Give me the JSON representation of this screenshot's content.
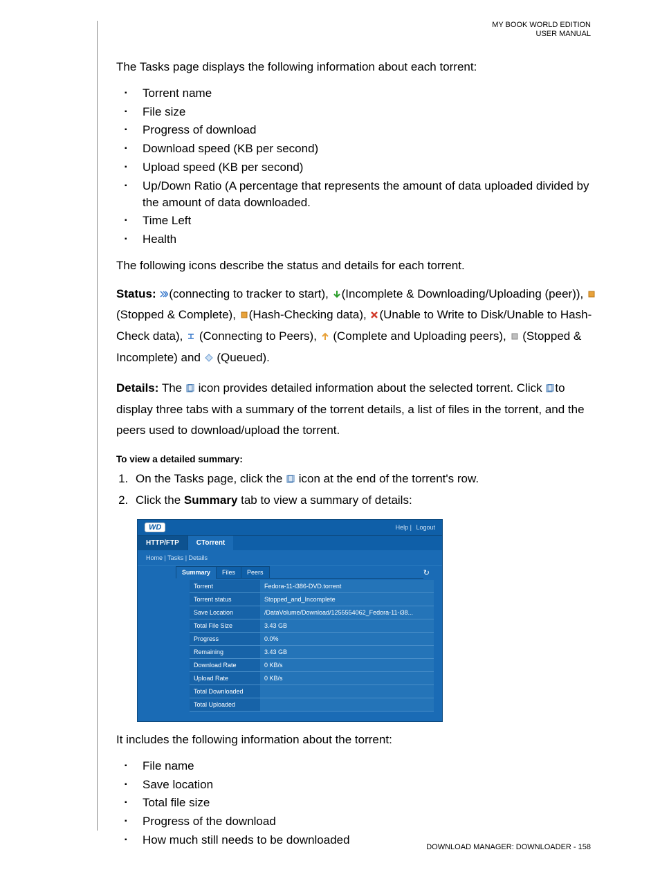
{
  "header": {
    "line1": "MY BOOK WORLD EDITION",
    "line2": "USER MANUAL"
  },
  "intro": "The Tasks page displays the following information about each torrent:",
  "tasks_info": [
    "Torrent name",
    "File size",
    "Progress of download",
    "Download speed (KB per second)",
    "Upload speed (KB per second)",
    "Up/Down Ratio (A percentage that represents the amount of data uploaded divided by the amount of data downloaded.",
    "Time Left",
    "Health"
  ],
  "icons_intro": "The following icons describe the status and details for each torrent.",
  "status": {
    "label": "Status:",
    "s1": "(connecting to tracker to start), ",
    "s2": "(Incomplete & Downloading/Uploading (peer)), ",
    "s3": "(Stopped & Complete), ",
    "s4": "(Hash-Checking data), ",
    "s5": "(Unable to Write to Disk/Unable to Hash-Check data), ",
    "s6": " (Connecting to Peers), ",
    "s7": " (Complete and Uploading peers), ",
    "s8": " (Stopped & Incomplete) and ",
    "s9": " (Queued)."
  },
  "details": {
    "label": "Details:",
    "t1": " The ",
    "t2": " icon provides detailed information about the selected torrent. Click ",
    "t3": "to display three tabs with a summary of the torrent details, a list of files in the torrent, and the peers used to download/upload the torrent."
  },
  "subhead": "To view a detailed summary:",
  "steps": {
    "s1a": "On the Tasks page, click the ",
    "s1b": " icon at the end of the torrent's row.",
    "s2a": "Click the ",
    "s2bold": "Summary",
    "s2b": " tab to view a summary of details:"
  },
  "screenshot": {
    "logo": "WD",
    "help": "Help",
    "logout": "Logout",
    "tab_http": "HTTP/FTP",
    "tab_ctorrent": "CTorrent",
    "crumbs": "Home | Tasks | Details",
    "refresh": "↻",
    "subtabs": {
      "summary": "Summary",
      "files": "Files",
      "peers": "Peers"
    },
    "rows": [
      {
        "l": "Torrent",
        "v": "Fedora-11-i386-DVD.torrent"
      },
      {
        "l": "Torrent status",
        "v": "Stopped_and_Incomplete"
      },
      {
        "l": "Save Location",
        "v": "/DataVolume/Download/1255554062_Fedora-11-i38..."
      },
      {
        "l": "Total File Size",
        "v": "3.43 GB"
      },
      {
        "l": "Progress",
        "v": "0.0%"
      },
      {
        "l": "Remaining",
        "v": "3.43 GB"
      },
      {
        "l": "Download Rate",
        "v": "0 KB/s"
      },
      {
        "l": "Upload Rate",
        "v": "0 KB/s"
      },
      {
        "l": "Total Downloaded",
        "v": ""
      },
      {
        "l": "Total Uploaded",
        "v": ""
      }
    ]
  },
  "after_ss": "It includes the following information about the torrent:",
  "torrent_info": [
    "File name",
    "Save location",
    "Total file size",
    "Progress of the download",
    "How much still needs to be downloaded"
  ],
  "footer": "DOWNLOAD MANAGER: DOWNLOADER - 158"
}
